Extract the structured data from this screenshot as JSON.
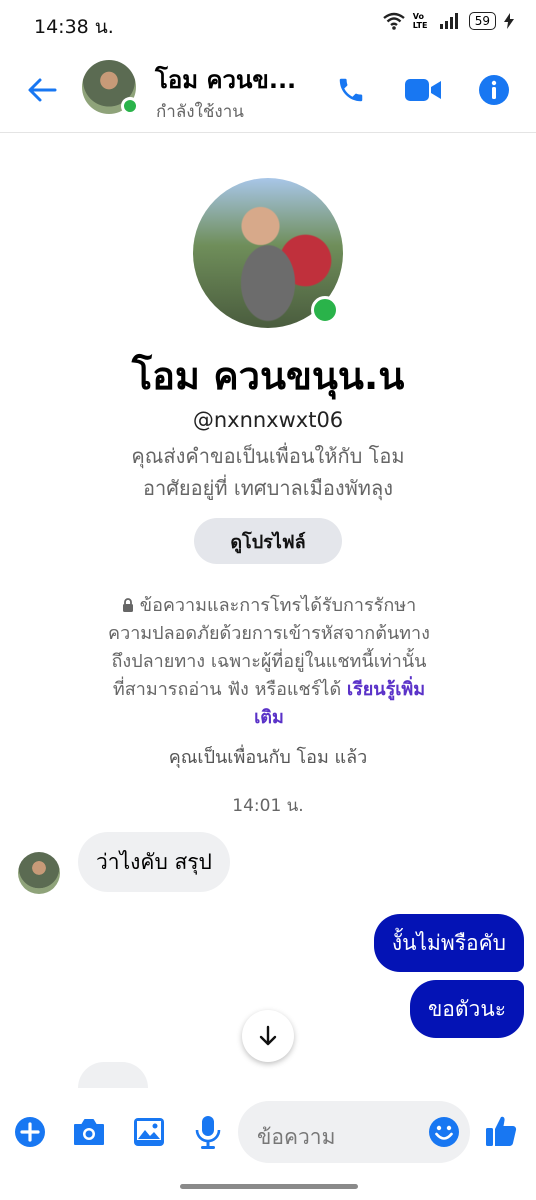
{
  "status_bar": {
    "time": "14:38 น.",
    "volte": "Vo LTE",
    "battery": "59"
  },
  "header": {
    "name": "โอม ควนข...",
    "status": "กำลังใช้งาน"
  },
  "profile": {
    "name": "โอม ควนขนุน.น",
    "username": "@nxnnxwxt06",
    "friend_request": "คุณส่งคำขอเป็นเพื่อนให้กับ โอม",
    "location": "อาศัยอยู่ที่ เทศบาลเมืองพัทลุง",
    "view_profile_label": "ดูโปรไฟล์"
  },
  "e2ee": {
    "line1": "ข้อความและการโทรได้รับการรักษา",
    "line2": "ความปลอดภัยด้วยการเข้ารหัสจากต้นทาง",
    "line3": "ถึงปลายทาง เฉพาะผู้ที่อยู่ในแชทนี้เท่านั้น",
    "line4": "ที่สามารถอ่าน ฟัง หรือแชร์ได้",
    "learn_more_a": "เรียนรู้เพิ่ม",
    "learn_more_b": "เติม"
  },
  "conversation": {
    "friends_note": "คุณเป็นเพื่อนกับ โอม แล้ว",
    "timestamp": "14:01 น.",
    "messages": [
      {
        "from": "them",
        "text": "ว่าไงคับ สรุป"
      },
      {
        "from": "me",
        "text": "งั้นไม่พรือคับ"
      },
      {
        "from": "me",
        "text": "ขอตัวนะ"
      }
    ]
  },
  "composer": {
    "placeholder": "ข้อความ"
  },
  "colors": {
    "accent": "#1877f2",
    "outgoing_bubble": "#0413b5",
    "online": "#2ab34a",
    "link": "#5a32c8"
  }
}
